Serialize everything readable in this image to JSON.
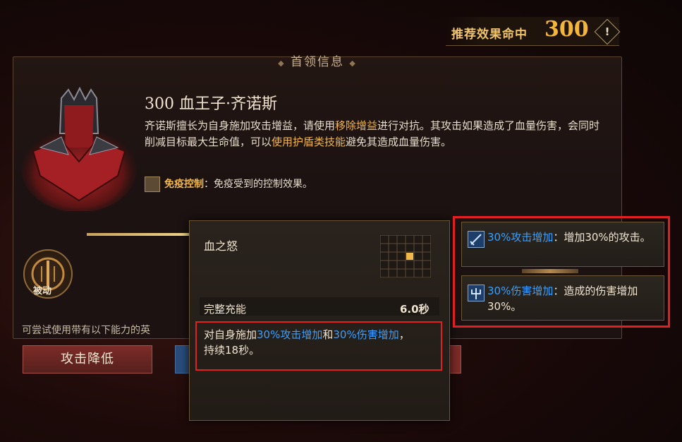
{
  "recommended": {
    "label": "推荐效果命中",
    "value": "300",
    "warn_icon": "!"
  },
  "panel": {
    "title": "首领信息",
    "boss_name": "300 血王子·齐诺斯",
    "desc_part1": "齐诺斯擅长为自身施加攻击增益，请使用",
    "desc_hl1": "移除增益",
    "desc_part2": "进行对抗。其攻击如果造成了血量伤害，会同时削减目标最大生命值，可以",
    "desc_hl2": "使用护盾类技能",
    "desc_part3": "避免其造成血量伤害。",
    "immune_key": "免疫控制",
    "immune_text": "：免疫受到的控制效果。",
    "passive_label": "被动",
    "try_text": "可尝试使用带有以下能力的英"
  },
  "buttons": {
    "attack_down": "攻击降低"
  },
  "tooltip": {
    "title": "血之怒",
    "charge_label": "完整充能",
    "charge_value": "6.0秒",
    "desc_a": "对自身施加",
    "desc_hl1": "30%攻击增加",
    "desc_b": "和",
    "desc_hl2": "30%伤害增加",
    "desc_c": "，持续18秒。"
  },
  "buffs": [
    {
      "name": "30%攻击增加",
      "text": "：增加30%的攻击。",
      "icon": "sword-icon"
    },
    {
      "name": "30%伤害增加",
      "text": "：造成的伤害增加30%。",
      "icon": "trident-icon"
    }
  ],
  "colors": {
    "gold": "#f1b64a",
    "blue": "#3aa0ff",
    "highlight_box": "#e02020"
  }
}
